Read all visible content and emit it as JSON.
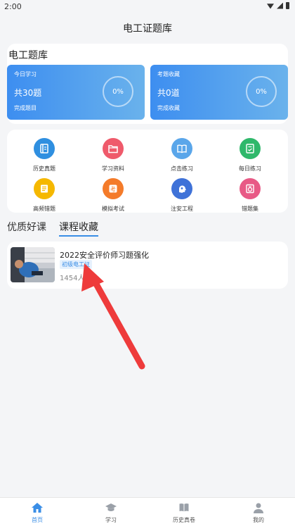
{
  "status": {
    "time": "2:00"
  },
  "header": {
    "title": "电工证题库"
  },
  "bank": {
    "title": "电工题库",
    "today": {
      "label": "今日学习",
      "count": "共30题",
      "sub": "完成题目",
      "percent": "0%"
    },
    "favorites": {
      "label": "考题收藏",
      "count": "共0道",
      "sub": "完成收藏",
      "percent": "0%"
    }
  },
  "grid": [
    {
      "label": "历史真题",
      "icon": "book-icon",
      "color": "#2f8fe0"
    },
    {
      "label": "学习资料",
      "icon": "folder-icon",
      "color": "#ef5a6b"
    },
    {
      "label": "点击练习",
      "icon": "open-book-icon",
      "color": "#5aa6ea"
    },
    {
      "label": "每日练习",
      "icon": "checklist-icon",
      "color": "#2fb86b"
    },
    {
      "label": "高频错题",
      "icon": "notes-icon",
      "color": "#f5b800"
    },
    {
      "label": "模拟考试",
      "icon": "exam-icon",
      "color": "#f47b2a"
    },
    {
      "label": "注安工程",
      "icon": "head-icon",
      "color": "#3f72d8"
    },
    {
      "label": "错题集",
      "icon": "repair-icon",
      "color": "#e85a86"
    }
  ],
  "tabs": {
    "quality": "优质好课",
    "favorites": "课程收藏"
  },
  "course": {
    "title": "2022安全评价师习题强化",
    "tag": "初级电工证",
    "count": "1454人"
  },
  "nav": [
    {
      "label": "首页",
      "icon": "home-icon"
    },
    {
      "label": "学习",
      "icon": "graduation-cap-icon"
    },
    {
      "label": "历史真卷",
      "icon": "book-icon"
    },
    {
      "label": "我的",
      "icon": "user-icon"
    }
  ]
}
